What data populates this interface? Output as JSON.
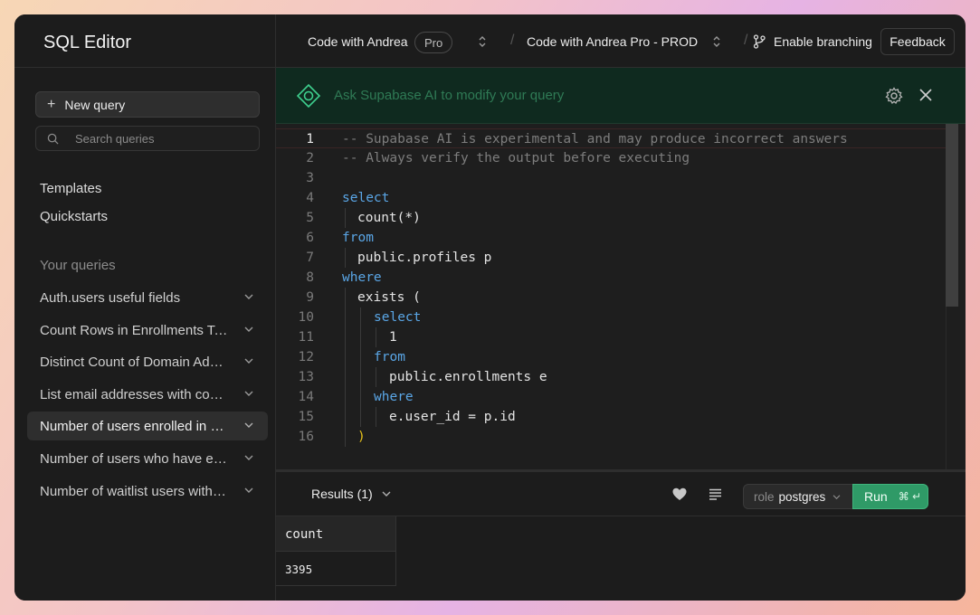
{
  "sidebar": {
    "title": "SQL Editor",
    "new_query_label": "New query",
    "search_placeholder": "Search queries",
    "links": [
      "Templates",
      "Quickstarts"
    ],
    "section_label": "Your queries",
    "queries": [
      "Auth.users useful fields",
      "Count Rows in Enrollments Table",
      "Distinct Count of Domain Addresses",
      "List email addresses with count",
      "Number of users enrolled in courses",
      "Number of users who have enrolled",
      "Number of waitlist users with profiles"
    ],
    "active_query_index": 4
  },
  "topbar": {
    "org_name": "Code with Andrea",
    "plan_badge": "Pro",
    "project_name": "Code with Andrea Pro - PROD",
    "branching_label": "Enable branching",
    "feedback_label": "Feedback"
  },
  "ai_bar": {
    "placeholder": "Ask Supabase AI to modify your query"
  },
  "editor": {
    "current_line": 1,
    "lines": [
      "-- Supabase AI is experimental and may produce incorrect answers",
      "-- Always verify the output before executing",
      "",
      "select",
      "count(*)",
      "from",
      "public.profiles p",
      "where",
      "exists (",
      "select",
      "1",
      "from",
      "public.enrollments e",
      "where",
      "e.user_id = p.id",
      ")"
    ]
  },
  "results": {
    "tab_label": "Results (1)",
    "role_prefix": "role",
    "role_value": "postgres",
    "run_label": "Run",
    "run_shortcut": "⌘ ↵",
    "columns": [
      "count"
    ],
    "rows": [
      [
        "3395"
      ]
    ]
  }
}
